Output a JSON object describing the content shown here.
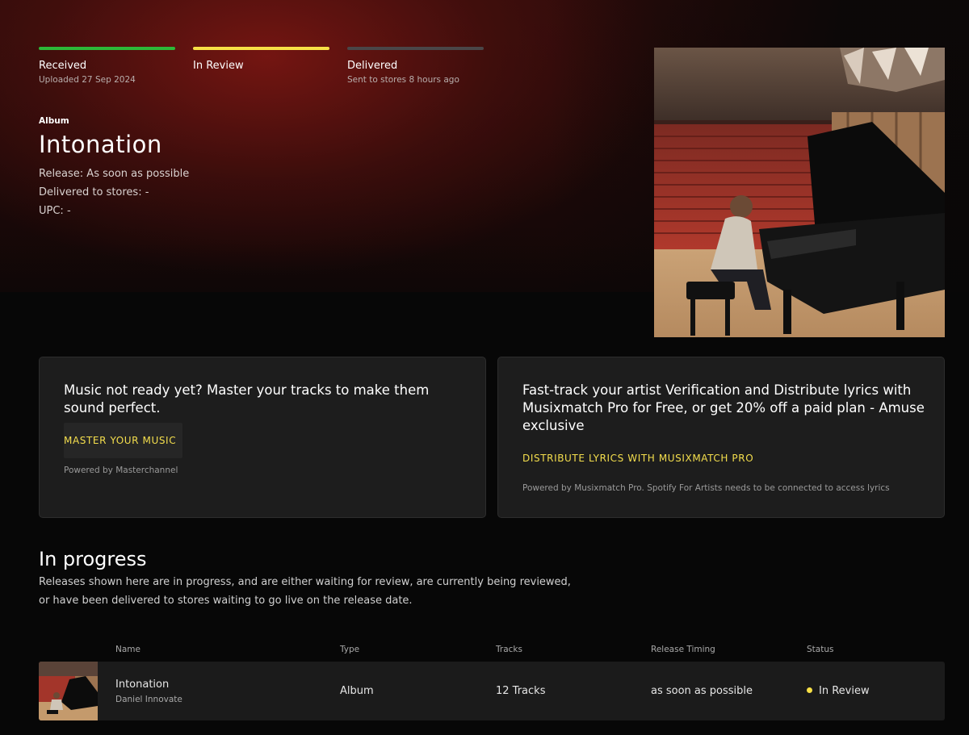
{
  "progress": {
    "steps": [
      {
        "label": "Received",
        "sub": "Uploaded 27 Sep 2024",
        "color": "#2db838"
      },
      {
        "label": "In Review",
        "sub": "",
        "color": "#f7e046"
      },
      {
        "label": "Delivered",
        "sub": "Sent to stores 8 hours ago",
        "color": "#4a4648"
      }
    ]
  },
  "release": {
    "type": "Album",
    "title": "Intonation",
    "release_line": "Release: As soon as possible",
    "delivered_line": "Delivered to stores: -",
    "upc_line": "UPC: -"
  },
  "promo_master": {
    "heading": "Music not ready yet? Master your tracks to make them sound perfect.",
    "cta": "MASTER YOUR MUSIC",
    "note": "Powered by Masterchannel"
  },
  "promo_musixmatch": {
    "heading": "Fast-track your artist Verification and Distribute lyrics with Musixmatch Pro for Free, or get 20% off a paid plan - Amuse exclusive",
    "cta": "DISTRIBUTE LYRICS WITH MUSIXMATCH PRO",
    "note": "Powered by Musixmatch Pro. Spotify For Artists needs to be connected to access lyrics"
  },
  "in_progress": {
    "title": "In progress",
    "description": "Releases shown here are in progress, and are either waiting for review, are currently being reviewed, or have been delivered to stores waiting to go live on the release date.",
    "columns": {
      "name": "Name",
      "type": "Type",
      "tracks": "Tracks",
      "timing": "Release Timing",
      "status": "Status"
    },
    "rows": [
      {
        "name": "Intonation",
        "artist": "Daniel Innovate",
        "type": "Album",
        "tracks": "12 Tracks",
        "timing": "as soon as possible",
        "status": "In Review",
        "status_color": "#f7e046"
      }
    ]
  },
  "colors": {
    "accent": "#f5df4d",
    "received": "#2db838",
    "review": "#f7e046"
  }
}
